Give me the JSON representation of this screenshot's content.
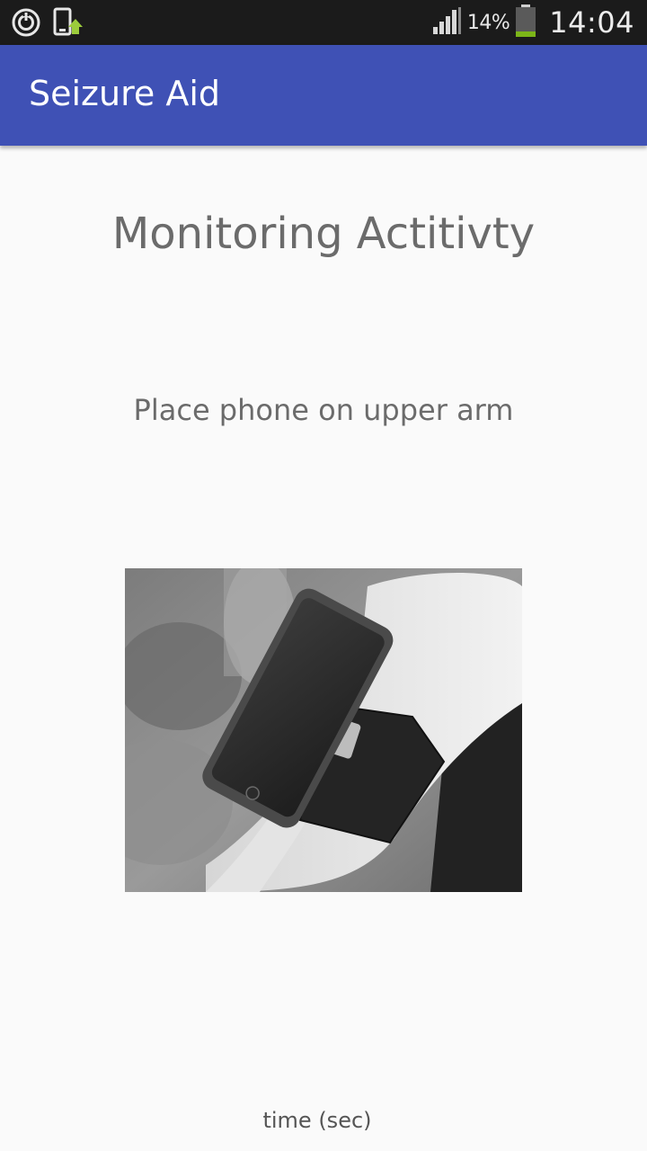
{
  "status_bar": {
    "battery_percent": "14%",
    "time": "14:04",
    "icons": [
      "power-saving-icon",
      "phone-sync-icon",
      "signal-icon",
      "battery-icon"
    ]
  },
  "app_bar": {
    "title": "Seizure Aid",
    "color": "#3f51b5"
  },
  "main": {
    "heading": "Monitoring Actitivty",
    "instruction": "Place phone on upper arm",
    "image": "phone-on-armband-photo",
    "axis_label": "time (sec)"
  }
}
